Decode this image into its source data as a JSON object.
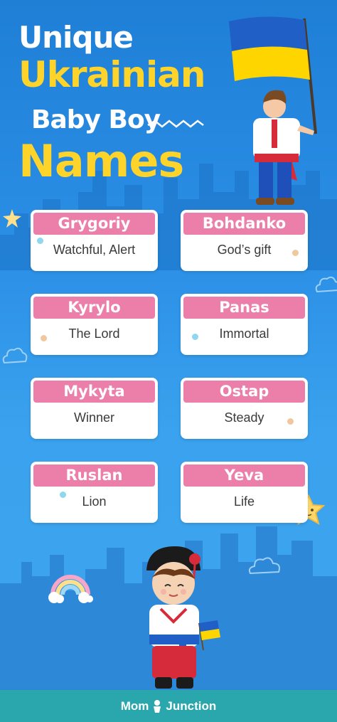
{
  "title": {
    "line1": "Unique",
    "line2": "Ukrainian",
    "line3": "Baby Boy",
    "line4": "Names"
  },
  "names": [
    {
      "name": "Grygoriy",
      "meaning": "Watchful, Alert"
    },
    {
      "name": "Bohdanko",
      "meaning": "God’s gift"
    },
    {
      "name": "Kyrylo",
      "meaning": "The Lord"
    },
    {
      "name": "Panas",
      "meaning": "Immortal"
    },
    {
      "name": "Mykyta",
      "meaning": "Winner"
    },
    {
      "name": "Ostap",
      "meaning": "Steady"
    },
    {
      "name": "Ruslan",
      "meaning": "Lion"
    },
    {
      "name": "Yeva",
      "meaning": "Life"
    }
  ],
  "footer": {
    "brand_left": "Mom",
    "brand_right": "Junction"
  },
  "colors": {
    "background": "#2b8fe6",
    "title_yellow": "#ffd42a",
    "tag_pink": "#ec7fa9",
    "footer_teal": "#2aa6ad",
    "flag_blue": "#1f5fc6",
    "flag_yellow": "#ffd500"
  },
  "icons": [
    "star-icon",
    "cloud-icon",
    "rainbow-icon",
    "ukraine-flag-icon",
    "momjunction-logo-icon"
  ]
}
